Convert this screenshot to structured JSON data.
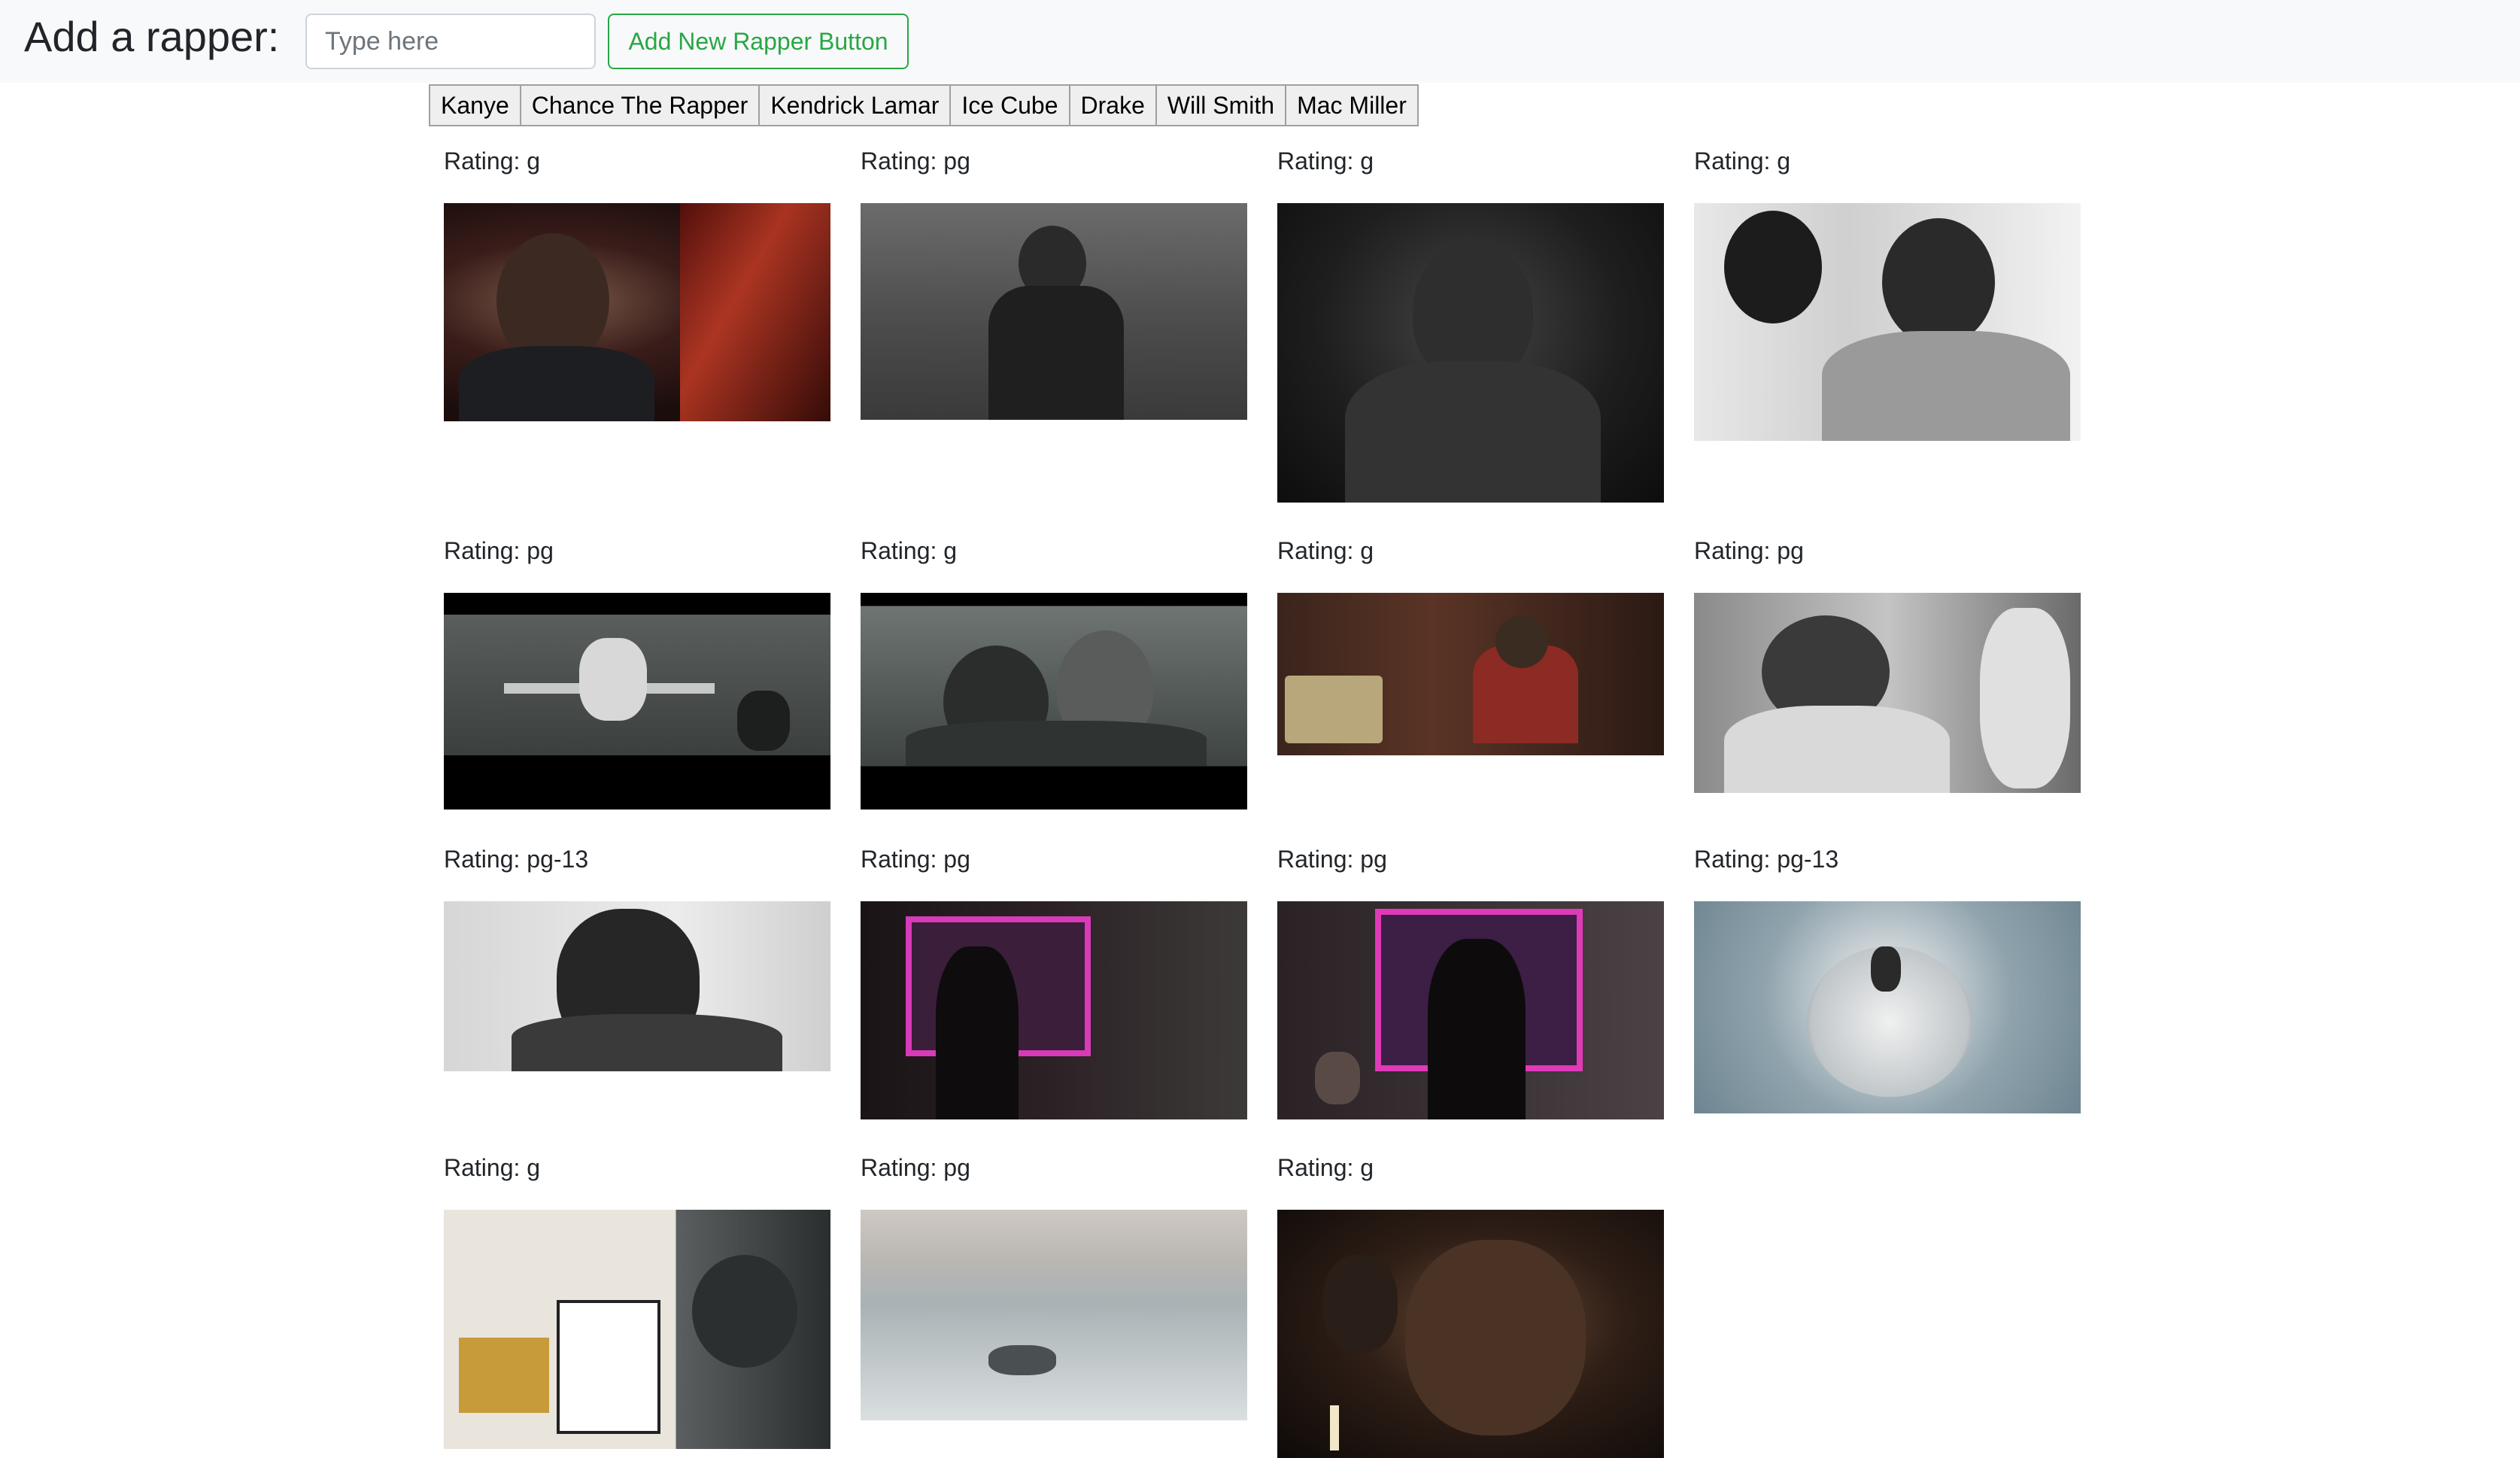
{
  "header": {
    "title": "Add a rapper:",
    "input_placeholder": "Type here",
    "add_button_label": "Add New Rapper Button"
  },
  "rappers": [
    {
      "label": "Kanye"
    },
    {
      "label": "Chance The Rapper"
    },
    {
      "label": "Kendrick Lamar"
    },
    {
      "label": "Ice Cube"
    },
    {
      "label": "Drake"
    },
    {
      "label": "Will Smith"
    },
    {
      "label": "Mac Miller"
    }
  ],
  "gifs": [
    {
      "rating": "Rating: g",
      "scene": "smiling-at-microphone"
    },
    {
      "rating": "Rating: pg",
      "scene": "crouching-with-lighter"
    },
    {
      "rating": "Rating: g",
      "scene": "hooded-portrait"
    },
    {
      "rating": "Rating: g",
      "scene": "looking-down-hand-on-head"
    },
    {
      "rating": "Rating: pg",
      "scene": "office-table-scene"
    },
    {
      "rating": "Rating: g",
      "scene": "two-men-close"
    },
    {
      "rating": "Rating: g",
      "scene": "money-stacks-room"
    },
    {
      "rating": "Rating: pg",
      "scene": "studio-headphones"
    },
    {
      "rating": "Rating: pg-13",
      "scene": "close-up-talking"
    },
    {
      "rating": "Rating: pg",
      "scene": "neon-window-figure"
    },
    {
      "rating": "Rating: pg",
      "scene": "neon-window-two-figures"
    },
    {
      "rating": "Rating: pg-13",
      "scene": "tiny-planet"
    },
    {
      "rating": "Rating: g",
      "scene": "sold-sign-poster"
    },
    {
      "rating": "Rating: pg",
      "scene": "car-on-river"
    },
    {
      "rating": "Rating: g",
      "scene": "candle-close-up"
    }
  ]
}
